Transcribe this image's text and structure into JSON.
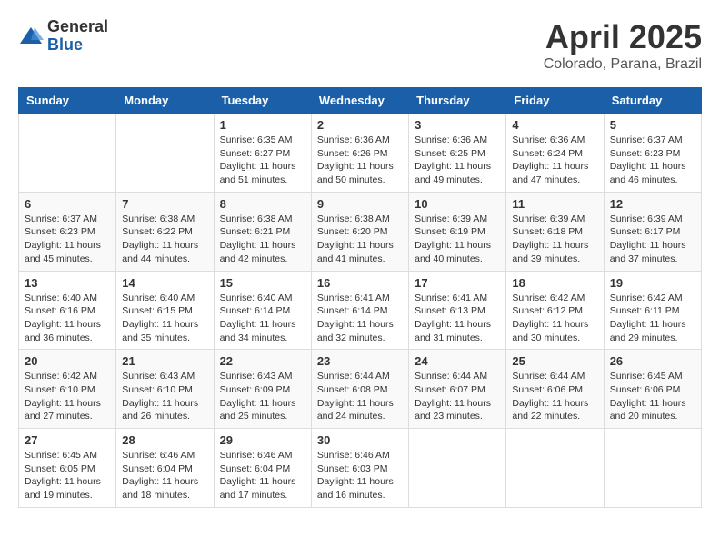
{
  "header": {
    "logo": {
      "general": "General",
      "blue": "Blue"
    },
    "title": "April 2025",
    "subtitle": "Colorado, Parana, Brazil"
  },
  "weekdays": [
    "Sunday",
    "Monday",
    "Tuesday",
    "Wednesday",
    "Thursday",
    "Friday",
    "Saturday"
  ],
  "weeks": [
    [
      {
        "day": null,
        "info": null
      },
      {
        "day": null,
        "info": null
      },
      {
        "day": "1",
        "info": "Sunrise: 6:35 AM\nSunset: 6:27 PM\nDaylight: 11 hours and 51 minutes."
      },
      {
        "day": "2",
        "info": "Sunrise: 6:36 AM\nSunset: 6:26 PM\nDaylight: 11 hours and 50 minutes."
      },
      {
        "day": "3",
        "info": "Sunrise: 6:36 AM\nSunset: 6:25 PM\nDaylight: 11 hours and 49 minutes."
      },
      {
        "day": "4",
        "info": "Sunrise: 6:36 AM\nSunset: 6:24 PM\nDaylight: 11 hours and 47 minutes."
      },
      {
        "day": "5",
        "info": "Sunrise: 6:37 AM\nSunset: 6:23 PM\nDaylight: 11 hours and 46 minutes."
      }
    ],
    [
      {
        "day": "6",
        "info": "Sunrise: 6:37 AM\nSunset: 6:23 PM\nDaylight: 11 hours and 45 minutes."
      },
      {
        "day": "7",
        "info": "Sunrise: 6:38 AM\nSunset: 6:22 PM\nDaylight: 11 hours and 44 minutes."
      },
      {
        "day": "8",
        "info": "Sunrise: 6:38 AM\nSunset: 6:21 PM\nDaylight: 11 hours and 42 minutes."
      },
      {
        "day": "9",
        "info": "Sunrise: 6:38 AM\nSunset: 6:20 PM\nDaylight: 11 hours and 41 minutes."
      },
      {
        "day": "10",
        "info": "Sunrise: 6:39 AM\nSunset: 6:19 PM\nDaylight: 11 hours and 40 minutes."
      },
      {
        "day": "11",
        "info": "Sunrise: 6:39 AM\nSunset: 6:18 PM\nDaylight: 11 hours and 39 minutes."
      },
      {
        "day": "12",
        "info": "Sunrise: 6:39 AM\nSunset: 6:17 PM\nDaylight: 11 hours and 37 minutes."
      }
    ],
    [
      {
        "day": "13",
        "info": "Sunrise: 6:40 AM\nSunset: 6:16 PM\nDaylight: 11 hours and 36 minutes."
      },
      {
        "day": "14",
        "info": "Sunrise: 6:40 AM\nSunset: 6:15 PM\nDaylight: 11 hours and 35 minutes."
      },
      {
        "day": "15",
        "info": "Sunrise: 6:40 AM\nSunset: 6:14 PM\nDaylight: 11 hours and 34 minutes."
      },
      {
        "day": "16",
        "info": "Sunrise: 6:41 AM\nSunset: 6:14 PM\nDaylight: 11 hours and 32 minutes."
      },
      {
        "day": "17",
        "info": "Sunrise: 6:41 AM\nSunset: 6:13 PM\nDaylight: 11 hours and 31 minutes."
      },
      {
        "day": "18",
        "info": "Sunrise: 6:42 AM\nSunset: 6:12 PM\nDaylight: 11 hours and 30 minutes."
      },
      {
        "day": "19",
        "info": "Sunrise: 6:42 AM\nSunset: 6:11 PM\nDaylight: 11 hours and 29 minutes."
      }
    ],
    [
      {
        "day": "20",
        "info": "Sunrise: 6:42 AM\nSunset: 6:10 PM\nDaylight: 11 hours and 27 minutes."
      },
      {
        "day": "21",
        "info": "Sunrise: 6:43 AM\nSunset: 6:10 PM\nDaylight: 11 hours and 26 minutes."
      },
      {
        "day": "22",
        "info": "Sunrise: 6:43 AM\nSunset: 6:09 PM\nDaylight: 11 hours and 25 minutes."
      },
      {
        "day": "23",
        "info": "Sunrise: 6:44 AM\nSunset: 6:08 PM\nDaylight: 11 hours and 24 minutes."
      },
      {
        "day": "24",
        "info": "Sunrise: 6:44 AM\nSunset: 6:07 PM\nDaylight: 11 hours and 23 minutes."
      },
      {
        "day": "25",
        "info": "Sunrise: 6:44 AM\nSunset: 6:06 PM\nDaylight: 11 hours and 22 minutes."
      },
      {
        "day": "26",
        "info": "Sunrise: 6:45 AM\nSunset: 6:06 PM\nDaylight: 11 hours and 20 minutes."
      }
    ],
    [
      {
        "day": "27",
        "info": "Sunrise: 6:45 AM\nSunset: 6:05 PM\nDaylight: 11 hours and 19 minutes."
      },
      {
        "day": "28",
        "info": "Sunrise: 6:46 AM\nSunset: 6:04 PM\nDaylight: 11 hours and 18 minutes."
      },
      {
        "day": "29",
        "info": "Sunrise: 6:46 AM\nSunset: 6:04 PM\nDaylight: 11 hours and 17 minutes."
      },
      {
        "day": "30",
        "info": "Sunrise: 6:46 AM\nSunset: 6:03 PM\nDaylight: 11 hours and 16 minutes."
      },
      {
        "day": null,
        "info": null
      },
      {
        "day": null,
        "info": null
      },
      {
        "day": null,
        "info": null
      }
    ]
  ]
}
